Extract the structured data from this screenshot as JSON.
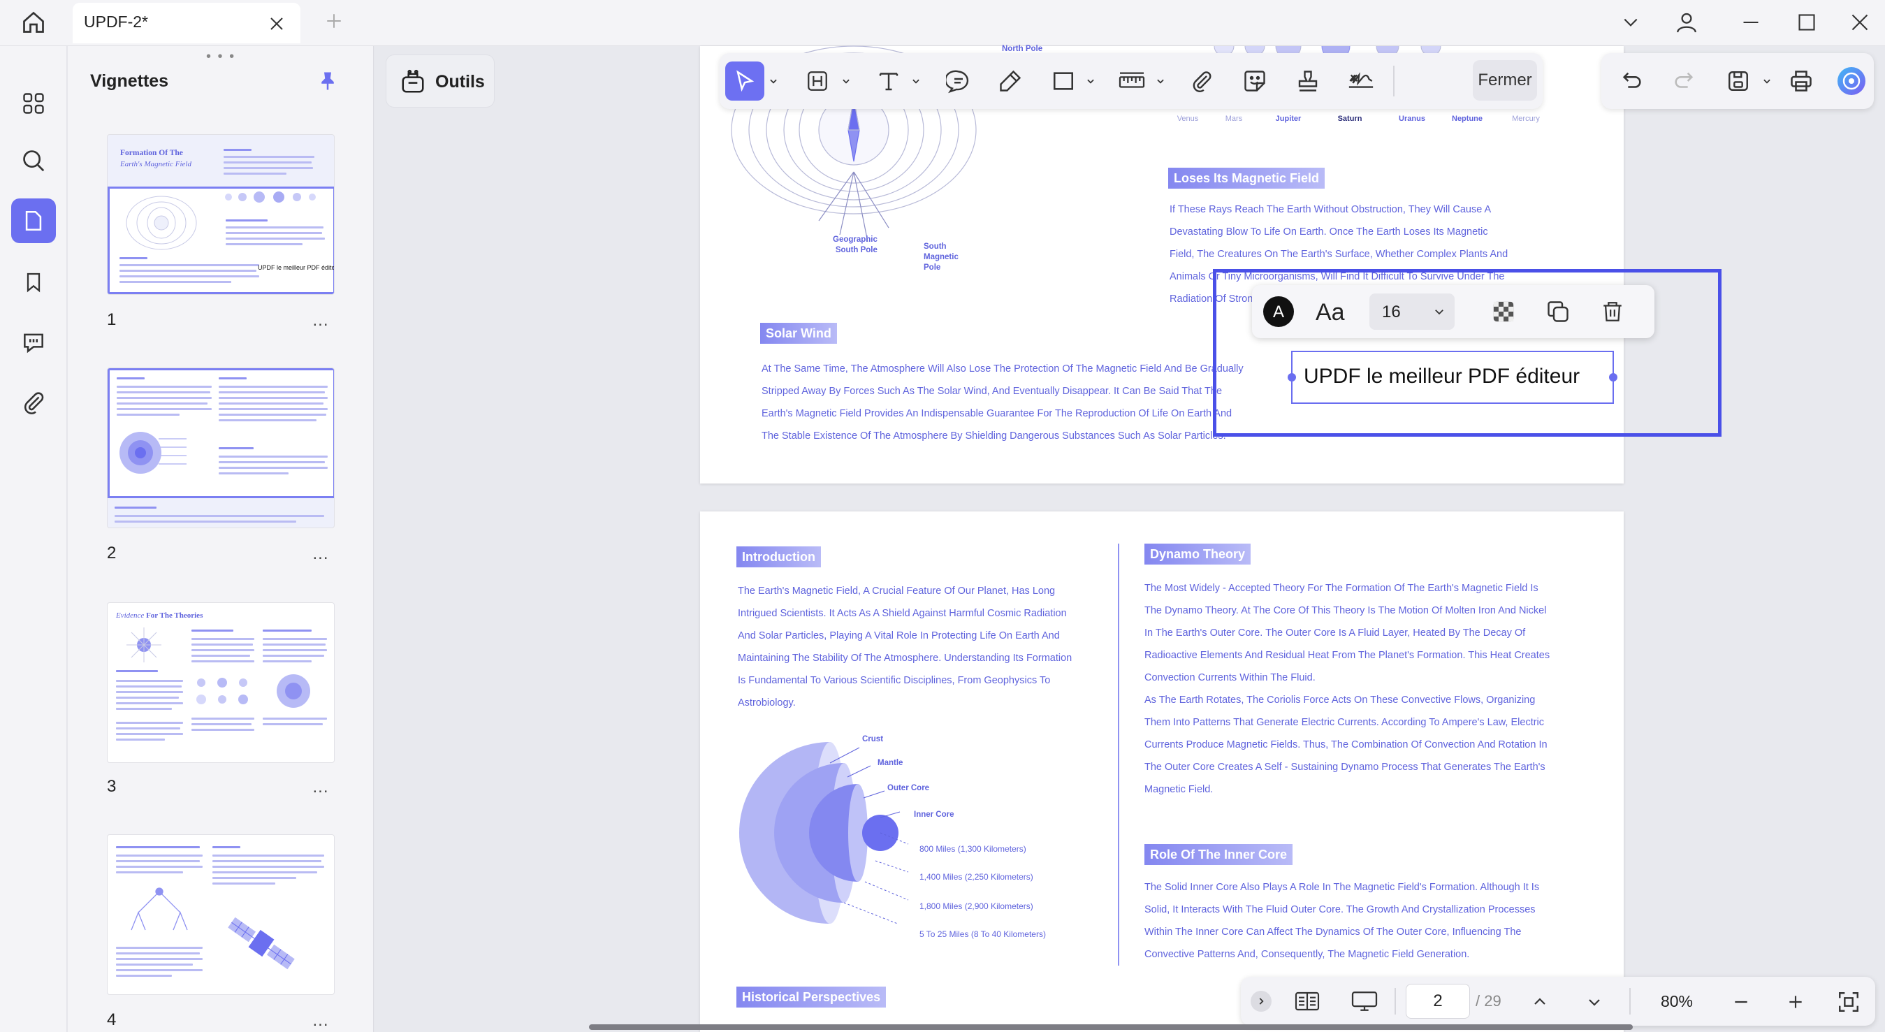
{
  "titlebar": {
    "tab_title": "UPDF-2*"
  },
  "thumbnails": {
    "title": "Vignettes",
    "more": "...",
    "pages": [
      {
        "number": "1",
        "heading_a": "Formation Of The",
        "heading_b": "Earth's Magnetic Field",
        "overlay_text": "UPDF  le meilleur PDF éditeur"
      },
      {
        "number": "2"
      },
      {
        "number": "3",
        "heading_a": "Evidence",
        "heading_b": "For The Theories"
      },
      {
        "number": "4"
      }
    ]
  },
  "tools": {
    "outils_label": "Outils"
  },
  "toolbar": {
    "close_label": "Fermer"
  },
  "page1": {
    "north_pole": "North Pole",
    "planets": [
      "Venus",
      "Mars",
      "Jupiter",
      "Saturn",
      "Uranus",
      "Neptune",
      "Mercury"
    ],
    "geo_south_pole": "Geographic\nSouth Pole",
    "south_magnetic_pole": "South\nMagnetic\nPole",
    "loses_title": "Loses Its Magnetic Field",
    "loses_lines": [
      "If These Rays Reach The Earth Without Obstruction, They Will Cause A",
      "Devastating Blow To Life On Earth. Once The Earth Loses Its Magnetic",
      "Field, The Creatures On The Earth's Surface, Whether Complex Plants And",
      "Animals Or Tiny Microorganisms, Will Find It Difficult To Survive Under The",
      "Radiation Of Strong"
    ],
    "solar_title": "Solar Wind",
    "solar_lines": [
      "At The Same Time, The Atmosphere Will Also Lose The Protection Of The Magnetic Field And Be Gradually",
      "Stripped Away By Forces Such As The Solar Wind, And Eventually Disappear. It Can Be Said That The",
      "Earth's Magnetic Field Provides An Indispensable Guarantee For The Reproduction Of Life On Earth And",
      "The Stable Existence Of The Atmosphere By Shielding Dangerous Substances Such As Solar Particles."
    ]
  },
  "annotation": {
    "text": "UPDF  le meilleur PDF éditeur",
    "font_size": "16"
  },
  "page2": {
    "intro_title": "Introduction",
    "intro_lines": [
      "The Earth's Magnetic Field, A Crucial Feature Of Our Planet, Has Long",
      "Intrigued Scientists. It Acts As A Shield Against Harmful Cosmic Radiation",
      "And Solar Particles, Playing A Vital Role In Protecting Life On Earth And",
      "Maintaining The Stability Of The Atmosphere. Understanding Its Formation",
      "Is Fundamental To Various Scientific Disciplines, From Geophysics To",
      "Astrobiology."
    ],
    "layers": [
      "Crust",
      "Mantle",
      "Outer Core",
      "Inner Core"
    ],
    "distances": [
      "800 Miles (1,300 Kilometers)",
      "1,400 Miles (2,250 Kilometers)",
      "1,800 Miles (2,900 Kilometers)",
      "5 To 25 Miles (8 To 40 Kilometers)"
    ],
    "historical_title": "Historical Perspectives",
    "dynamo_title": "Dynamo Theory",
    "dynamo_lines": [
      "The Most Widely - Accepted Theory For The Formation Of The Earth's Magnetic Field Is",
      "The Dynamo Theory. At The Core Of This Theory Is The Motion Of Molten Iron And Nickel",
      "In The Earth's Outer Core. The Outer Core Is A Fluid Layer, Heated By The Decay Of",
      "Radioactive Elements And Residual Heat From The Planet's Formation. This Heat Creates",
      "Convection Currents Within The Fluid.",
      "As The Earth Rotates, The Coriolis Force Acts On These Convective Flows, Organizing",
      "Them Into Patterns That Generate Electric Currents. According To Ampere's Law, Electric",
      "Currents Produce Magnetic Fields. Thus, The Combination Of Convection And Rotation In",
      "The Outer Core Creates A Self - Sustaining Dynamo Process That Generates The Earth's",
      "Magnetic Field."
    ],
    "inner_title": "Role Of The Inner Core",
    "inner_lines": [
      "The Solid Inner Core Also Plays A Role In The Magnetic Field's Formation. Although It Is",
      "Solid, It Interacts With The Fluid Outer Core. The Growth And Crystallization Processes",
      "Within The Inner Core Can Affect The Dynamics Of The Outer Core, Influencing The",
      "Convective Patterns And, Consequently, The Magnetic Field Generation."
    ]
  },
  "bottombar": {
    "page_value": "2",
    "page_total": "/ 29",
    "zoom": "80%"
  }
}
